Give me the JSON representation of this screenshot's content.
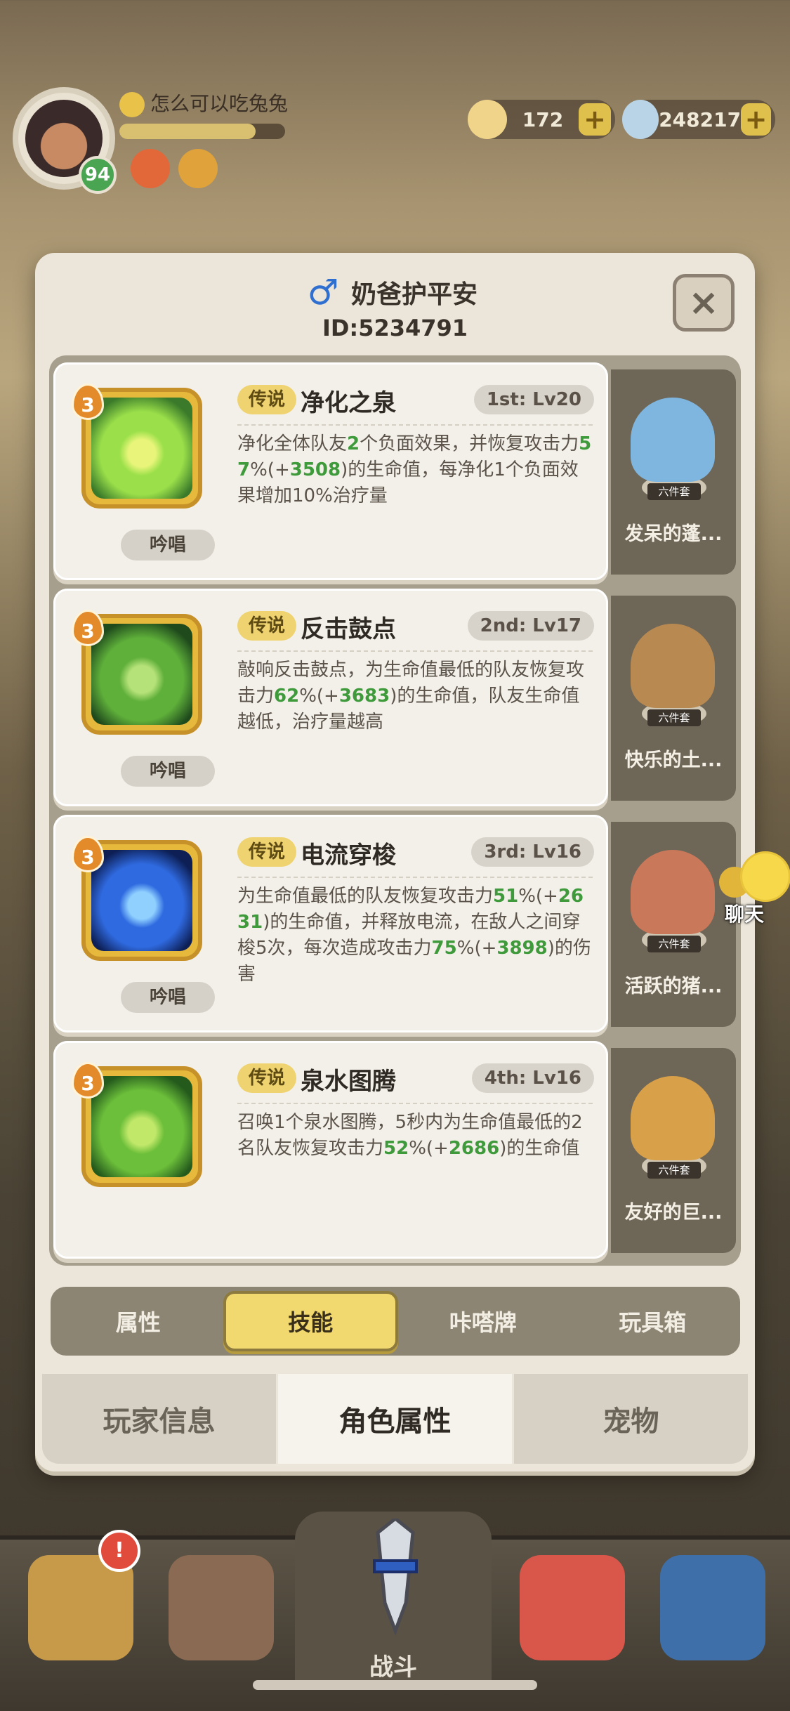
{
  "hud": {
    "player_level": "94",
    "player_name": "怎么可以吃兔兔",
    "xp_progress": 0.82,
    "currency_shells": "172",
    "currency_gems": "248217",
    "plus_label": "+"
  },
  "profile": {
    "gender_icon": "male-icon",
    "name": "奶爸护平安",
    "id": "ID:5234791",
    "close_label": "×"
  },
  "skills": [
    {
      "level_badge": "3",
      "rarity": "传说",
      "name": "净化之泉",
      "rank": "1st: Lv20",
      "cast_type": "吟唱",
      "description_parts": [
        {
          "t": "净化全体队友"
        },
        {
          "t": "2",
          "hl": true
        },
        {
          "t": "个负面效果，并恢复攻击力"
        },
        {
          "t": "57",
          "hl": true
        },
        {
          "t": "%(+"
        },
        {
          "t": "3508",
          "hl": true
        },
        {
          "t": ")的生命值，每净化1个负面效果增加10%治疗量"
        }
      ],
      "pet_name": "发呆的蓬...",
      "pet_set": "六件套",
      "icon_colors": [
        "#3a7a2a",
        "#9be04a",
        "#e9f57a"
      ]
    },
    {
      "level_badge": "3",
      "rarity": "传说",
      "name": "反击鼓点",
      "rank": "2nd: Lv17",
      "cast_type": "吟唱",
      "description_parts": [
        {
          "t": "敲响反击鼓点，为生命值最低的队友恢复攻击力"
        },
        {
          "t": "62",
          "hl": true
        },
        {
          "t": "%(+"
        },
        {
          "t": "3683",
          "hl": true
        },
        {
          "t": ")的生命值，队友生命值越低，治疗量越高"
        }
      ],
      "pet_name": "快乐的土...",
      "pet_set": "六件套",
      "icon_colors": [
        "#1f4a1c",
        "#5fb03a",
        "#b6e27a"
      ]
    },
    {
      "level_badge": "3",
      "rarity": "传说",
      "name": "电流穿梭",
      "rank": "3rd: Lv16",
      "cast_type": "吟唱",
      "description_parts": [
        {
          "t": "为生命值最低的队友恢复攻击力"
        },
        {
          "t": "51",
          "hl": true
        },
        {
          "t": "%(+"
        },
        {
          "t": "2631",
          "hl": true
        },
        {
          "t": ")的生命值，并释放电流，在敌人之间穿梭5次，每次造成攻击力"
        },
        {
          "t": "75",
          "hl": true
        },
        {
          "t": "%(+"
        },
        {
          "t": "3898",
          "hl": true
        },
        {
          "t": ")的伤害"
        }
      ],
      "pet_name": "活跃的猪...",
      "pet_set": "六件套",
      "icon_colors": [
        "#0d1f55",
        "#2f6ae0",
        "#8fd0ff"
      ]
    },
    {
      "level_badge": "3",
      "rarity": "传说",
      "name": "泉水图腾",
      "rank": "4th: Lv16",
      "cast_type": "",
      "description_parts": [
        {
          "t": "召唤1个泉水图腾，5秒内为生命值最低的2名队友恢复攻击力"
        },
        {
          "t": "52",
          "hl": true
        },
        {
          "t": "%(+"
        },
        {
          "t": "2686",
          "hl": true
        },
        {
          "t": ")的生命值"
        }
      ],
      "pet_name": "友好的巨...",
      "pet_set": "六件套",
      "icon_colors": [
        "#245a1c",
        "#6cbf3a",
        "#c2e86a"
      ]
    }
  ],
  "sub_tabs": [
    {
      "label": "属性",
      "active": false
    },
    {
      "label": "技能",
      "active": true
    },
    {
      "label": "咔嗒牌",
      "active": false
    },
    {
      "label": "玩具箱",
      "active": false
    }
  ],
  "bottom_tabs": [
    {
      "label": "玩家信息",
      "active": false
    },
    {
      "label": "角色属性",
      "active": true
    },
    {
      "label": "宠物",
      "active": false
    }
  ],
  "chat": {
    "label": "聊天"
  },
  "nav": {
    "battle_label": "战斗",
    "notification_count": "!"
  },
  "colors": {
    "accent_yellow": "#f1d86f",
    "highlight_green": "#3e9a3a",
    "gender_blue": "#2f6fd0"
  }
}
